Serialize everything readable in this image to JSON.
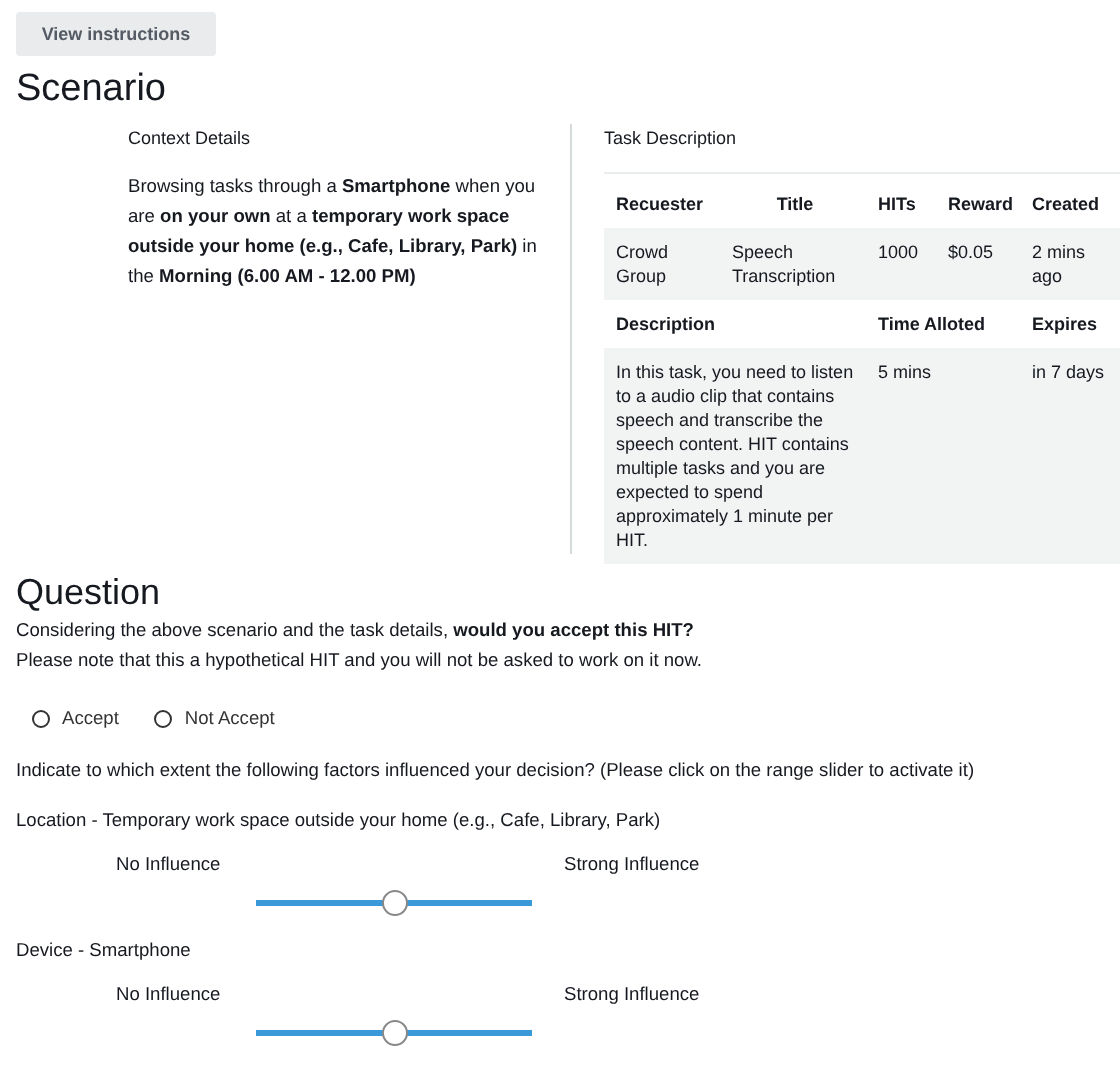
{
  "view_button": "View instructions",
  "scenario": {
    "heading": "Scenario",
    "context_title": "Context Details",
    "context_text": "Browsing tasks through a **Smartphone** when you are **on your own** at a **temporary work space outside your home (e.g., Cafe, Library, Park)** in the **Morning (6.00 AM - 12.00 PM)**"
  },
  "task": {
    "title": "Task Description",
    "columns": [
      "Recuester",
      "Title",
      "HITs",
      "Reward",
      "Created"
    ],
    "row": [
      "Crowd Group",
      "Speech Transcription",
      "1000",
      "$0.05",
      "2 mins ago"
    ],
    "columns_2": [
      "Description",
      "Time Alloted",
      "Expires"
    ],
    "row_2": [
      "In this task, you need to listen to a audio clip that contains speech and transcribe the speech content. HIT contains multiple tasks and you are expected to spend approximately 1 minute per HIT.",
      "5 mins",
      "in 7 days"
    ]
  },
  "question": {
    "heading": "Question",
    "prompt": "Considering the above scenario and the task details, **would you accept this HIT?**",
    "note": "Please note that this a hypothetical HIT and you will not be asked to work on it now.",
    "options": [
      {
        "label": "Accept",
        "selected": false
      },
      {
        "label": "Not Accept",
        "selected": false
      }
    ],
    "factors_prompt": "Indicate to which extent the following factors influenced your decision? (Please click on the range slider to activate it)",
    "factors": [
      {
        "label": "Location - Temporary work space outside your home (e.g., Cafe, Library, Park)",
        "low": "No Influence",
        "high": "Strong Influence",
        "level": 0.5
      },
      {
        "label": "Device - Smartphone",
        "low": "No Influence",
        "high": "Strong Influence",
        "level": 0.5
      }
    ]
  }
}
